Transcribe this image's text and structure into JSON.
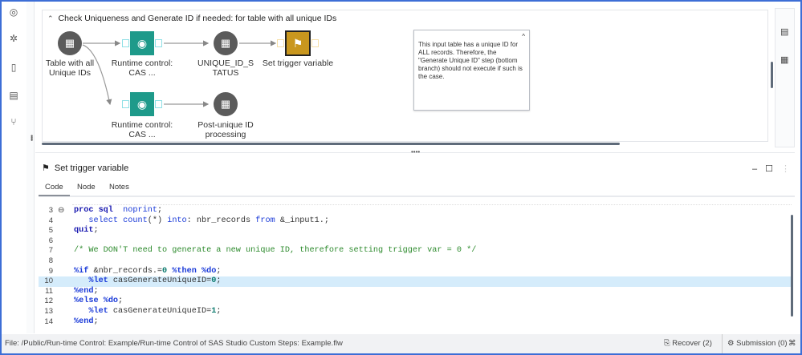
{
  "rail_icons": [
    "steps-icon",
    "gear-icon",
    "file-macro-icon",
    "libraries-icon",
    "git-branch-icon"
  ],
  "flow": {
    "title": "Check Uniqueness and Generate ID if needed: for table with all unique IDs",
    "nodes": [
      {
        "label": "Table with all Unique IDs",
        "type": "table"
      },
      {
        "label": "Runtime control: CAS ...",
        "type": "runtime-control"
      },
      {
        "label": "UNIQUE_ID_S TATUS",
        "type": "table"
      },
      {
        "label": "Set trigger variable",
        "type": "sas-program",
        "selected": true
      },
      {
        "label": "Runtime control: CAS ...",
        "type": "runtime-control"
      },
      {
        "label": "Post-unique ID processing",
        "type": "table"
      }
    ],
    "note": "This input table has a unique ID for ALL records.  Therefore, the \"Generate Unique ID\" step (bottom branch) should not execute if such is the case.",
    "colors": {
      "table": "#5b5b5b",
      "runtime": "#1e9a8a",
      "program": "#c9971e"
    }
  },
  "pane": {
    "title": "Set trigger variable",
    "tabs": [
      "Code",
      "Node",
      "Notes"
    ],
    "active_tab": "Code"
  },
  "code": {
    "highlighted_line": 10,
    "lines": [
      {
        "n": "3",
        "fold": true,
        "tokens": [
          [
            "kw",
            "proc sql"
          ],
          [
            "",
            "  "
          ],
          [
            "fn",
            "noprint"
          ],
          [
            "",
            ";"
          ]
        ]
      },
      {
        "n": "4",
        "tokens": [
          [
            "",
            "   "
          ],
          [
            "fn",
            "select"
          ],
          [
            "",
            " "
          ],
          [
            "fn",
            "count"
          ],
          [
            "",
            "(*) "
          ],
          [
            "fn",
            "into"
          ],
          [
            "",
            ": nbr_records "
          ],
          [
            "fn",
            "from"
          ],
          [
            "",
            " &_input1.;"
          ]
        ]
      },
      {
        "n": "5",
        "tokens": [
          [
            "kw",
            "quit"
          ],
          [
            "",
            ";"
          ]
        ]
      },
      {
        "n": "6",
        "tokens": []
      },
      {
        "n": "7",
        "tokens": [
          [
            "cm",
            "/* We DON'T need to generate a new unique ID, therefore setting trigger var = 0 */"
          ]
        ]
      },
      {
        "n": "8",
        "tokens": []
      },
      {
        "n": "9",
        "tokens": [
          [
            "mc",
            "%if"
          ],
          [
            "",
            " &nbr_records.="
          ],
          [
            "nm",
            "0"
          ],
          [
            "",
            " "
          ],
          [
            "mc",
            "%then"
          ],
          [
            "",
            " "
          ],
          [
            "mc",
            "%do"
          ],
          [
            "",
            ";"
          ]
        ]
      },
      {
        "n": "10",
        "tokens": [
          [
            "",
            "   "
          ],
          [
            "mc",
            "%let"
          ],
          [
            "",
            " casGenerateUniqueID="
          ],
          [
            "nm",
            "0"
          ],
          [
            "",
            ";"
          ]
        ]
      },
      {
        "n": "11",
        "tokens": [
          [
            "mc",
            "%end"
          ],
          [
            "",
            ";"
          ]
        ]
      },
      {
        "n": "12",
        "tokens": [
          [
            "mc",
            "%else"
          ],
          [
            "",
            " "
          ],
          [
            "mc",
            "%do"
          ],
          [
            "",
            ";"
          ]
        ]
      },
      {
        "n": "13",
        "tokens": [
          [
            "",
            "   "
          ],
          [
            "mc",
            "%let"
          ],
          [
            "",
            " casGenerateUniqueID="
          ],
          [
            "nm",
            "1"
          ],
          [
            "",
            ";"
          ]
        ]
      },
      {
        "n": "14",
        "tokens": [
          [
            "mc",
            "%end"
          ],
          [
            "",
            ";"
          ]
        ]
      }
    ]
  },
  "status": {
    "file": "File: /Public/Run-time Control: Example/Run-time Control of SAS Studio Custom Steps: Example.flw",
    "recover": "Recover (2)",
    "submission": "Submission (0)"
  },
  "accent": "#3d6ed6"
}
